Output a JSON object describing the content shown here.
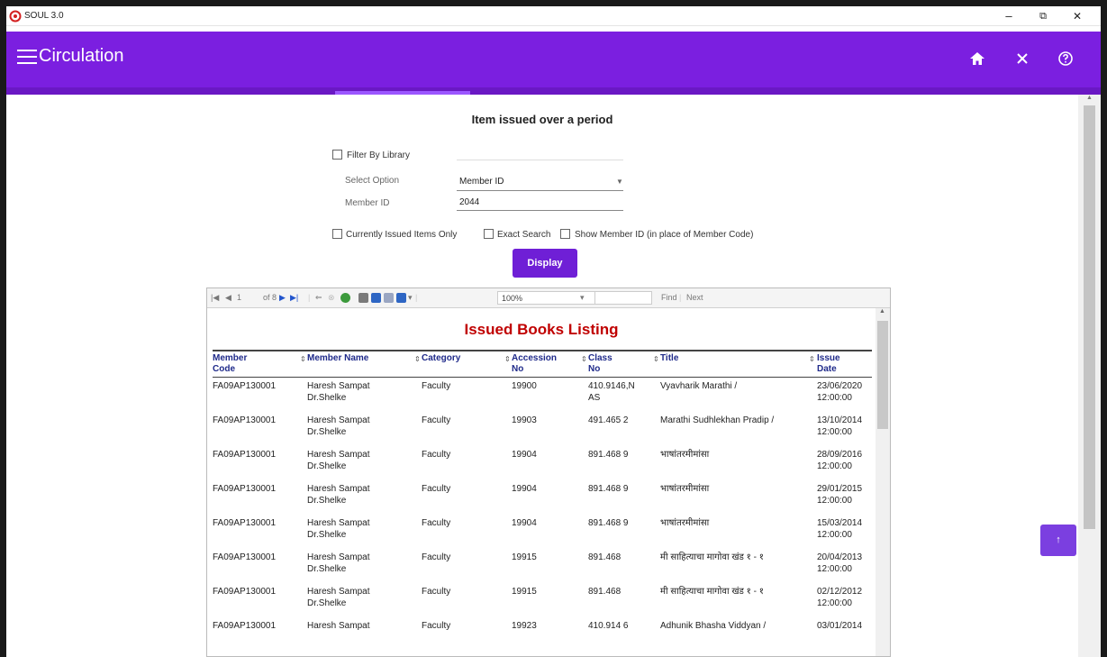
{
  "window": {
    "title": "SOUL 3.0",
    "minimize": "–",
    "restore": "⧉",
    "close": "✕"
  },
  "header": {
    "title": "Circulation",
    "home_icon": "home-icon",
    "close_icon": "close-icon",
    "help_icon": "help-icon",
    "bg": "#7b1fe0"
  },
  "form": {
    "page_title": "Item issued over a period",
    "filter_by_library": "Filter By Library",
    "select_option_label": "Select Option",
    "select_option_value": "Member ID",
    "member_id_label": "Member ID",
    "member_id_value": "2044",
    "currently_issued": "Currently Issued Items Only",
    "exact_search": "Exact Search",
    "show_member_id": "Show Member ID (in place of Member Code)",
    "display_button": "Display"
  },
  "report": {
    "toolbar": {
      "page": "1",
      "of_pages": "of 8",
      "zoom": "100%",
      "find": "Find",
      "sep": "|",
      "next": "Next"
    },
    "title": "Issued Books Listing",
    "columns": [
      {
        "key": "member_code",
        "l1": "Member",
        "l2": "Code"
      },
      {
        "key": "member_name",
        "l1": "Member Name",
        "l2": ""
      },
      {
        "key": "category",
        "l1": "Category",
        "l2": ""
      },
      {
        "key": "accession",
        "l1": "Accession",
        "l2": "No"
      },
      {
        "key": "class",
        "l1": "Class",
        "l2": "No"
      },
      {
        "key": "title",
        "l1": "Title",
        "l2": ""
      },
      {
        "key": "issue_date",
        "l1": "Issue",
        "l2": "Date"
      }
    ],
    "rows": [
      {
        "code": "FA09AP130001",
        "name1": "Haresh Sampat",
        "name2": "Dr.Shelke",
        "category": "Faculty",
        "accession": "19900",
        "class1": "410.9146,N",
        "class2": "AS",
        "title": "Vyavharik Marathi /",
        "date1": "23/06/2020",
        "date2": "12:00:00"
      },
      {
        "code": "FA09AP130001",
        "name1": "Haresh Sampat",
        "name2": "Dr.Shelke",
        "category": "Faculty",
        "accession": "19903",
        "class1": "491.465 2",
        "class2": "",
        "title": "Marathi Sudhlekhan Pradip /",
        "date1": "13/10/2014",
        "date2": "12:00:00"
      },
      {
        "code": "FA09AP130001",
        "name1": "Haresh Sampat",
        "name2": "Dr.Shelke",
        "category": "Faculty",
        "accession": "19904",
        "class1": "891.468 9",
        "class2": "",
        "title": "भाषांतरमीमांसा",
        "date1": "28/09/2016",
        "date2": "12:00:00"
      },
      {
        "code": "FA09AP130001",
        "name1": "Haresh Sampat",
        "name2": "Dr.Shelke",
        "category": "Faculty",
        "accession": "19904",
        "class1": "891.468 9",
        "class2": "",
        "title": "भाषांतरमीमांसा",
        "date1": "29/01/2015",
        "date2": "12:00:00"
      },
      {
        "code": "FA09AP130001",
        "name1": "Haresh Sampat",
        "name2": "Dr.Shelke",
        "category": "Faculty",
        "accession": "19904",
        "class1": "891.468 9",
        "class2": "",
        "title": "भाषांतरमीमांसा",
        "date1": "15/03/2014",
        "date2": "12:00:00"
      },
      {
        "code": "FA09AP130001",
        "name1": "Haresh Sampat",
        "name2": "Dr.Shelke",
        "category": "Faculty",
        "accession": "19915",
        "class1": "891.468",
        "class2": "",
        "title": "मी साहित्याचा मागोवा खंड १ - १",
        "date1": "20/04/2013",
        "date2": "12:00:00"
      },
      {
        "code": "FA09AP130001",
        "name1": "Haresh Sampat",
        "name2": "Dr.Shelke",
        "category": "Faculty",
        "accession": "19915",
        "class1": "891.468",
        "class2": "",
        "title": "मी साहित्याचा मागोवा खंड १ - १",
        "date1": "02/12/2012",
        "date2": "12:00:00"
      },
      {
        "code": "FA09AP130001",
        "name1": "Haresh Sampat",
        "name2": "",
        "category": "Faculty",
        "accession": "19923",
        "class1": "410.914 6",
        "class2": "",
        "title": "Adhunik Bhasha Viddyan /",
        "date1": "03/01/2014",
        "date2": ""
      }
    ]
  },
  "scroll_top_button": "↑"
}
